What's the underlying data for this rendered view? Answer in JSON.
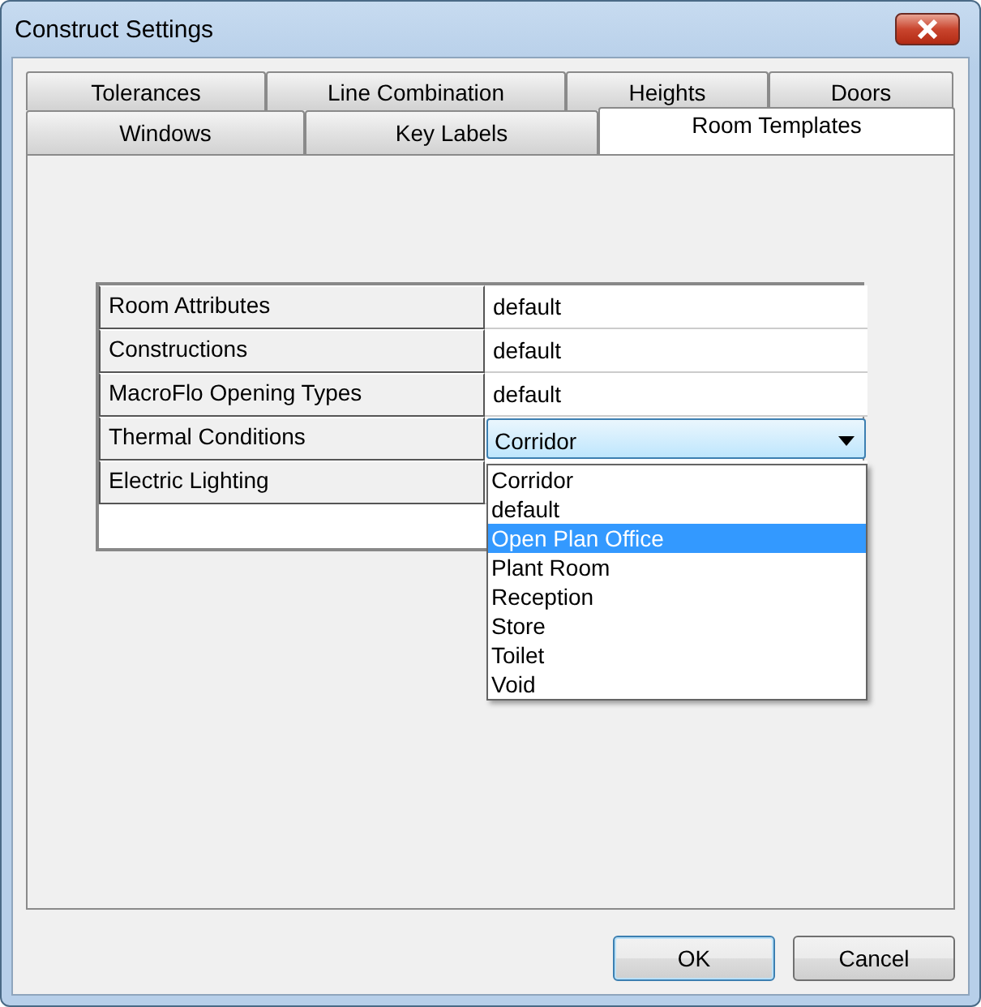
{
  "window": {
    "title": "Construct Settings"
  },
  "tab_rows": [
    [
      {
        "label": "Tolerances",
        "selected": false
      },
      {
        "label": "Line Combination",
        "selected": false
      },
      {
        "label": "Heights",
        "selected": false
      },
      {
        "label": "Doors",
        "selected": false
      }
    ],
    [
      {
        "label": "Windows",
        "selected": false
      },
      {
        "label": "Key Labels",
        "selected": false
      },
      {
        "label": "Room Templates",
        "selected": true
      }
    ]
  ],
  "grid": {
    "rows": [
      {
        "label": "Room Attributes",
        "kind": "text",
        "value": "default"
      },
      {
        "label": "Constructions",
        "kind": "text",
        "value": "default"
      },
      {
        "label": "MacroFlo Opening Types",
        "kind": "text",
        "value": "default"
      },
      {
        "label": "Thermal Conditions",
        "kind": "combo",
        "value": "Corridor",
        "expanded": true
      },
      {
        "label": "Electric Lighting",
        "kind": "text"
      }
    ]
  },
  "dropdown": {
    "options": [
      {
        "label": "Corridor",
        "selected": false
      },
      {
        "label": "default",
        "selected": false
      },
      {
        "label": "Open Plan Office",
        "selected": true
      },
      {
        "label": "Plant Room",
        "selected": false
      },
      {
        "label": "Reception",
        "selected": false
      },
      {
        "label": "Store",
        "selected": false
      },
      {
        "label": "Toilet",
        "selected": false
      },
      {
        "label": "Void",
        "selected": false
      }
    ]
  },
  "buttons": [
    {
      "label": "OK",
      "default": true
    },
    {
      "label": "Cancel",
      "default": false
    }
  ]
}
